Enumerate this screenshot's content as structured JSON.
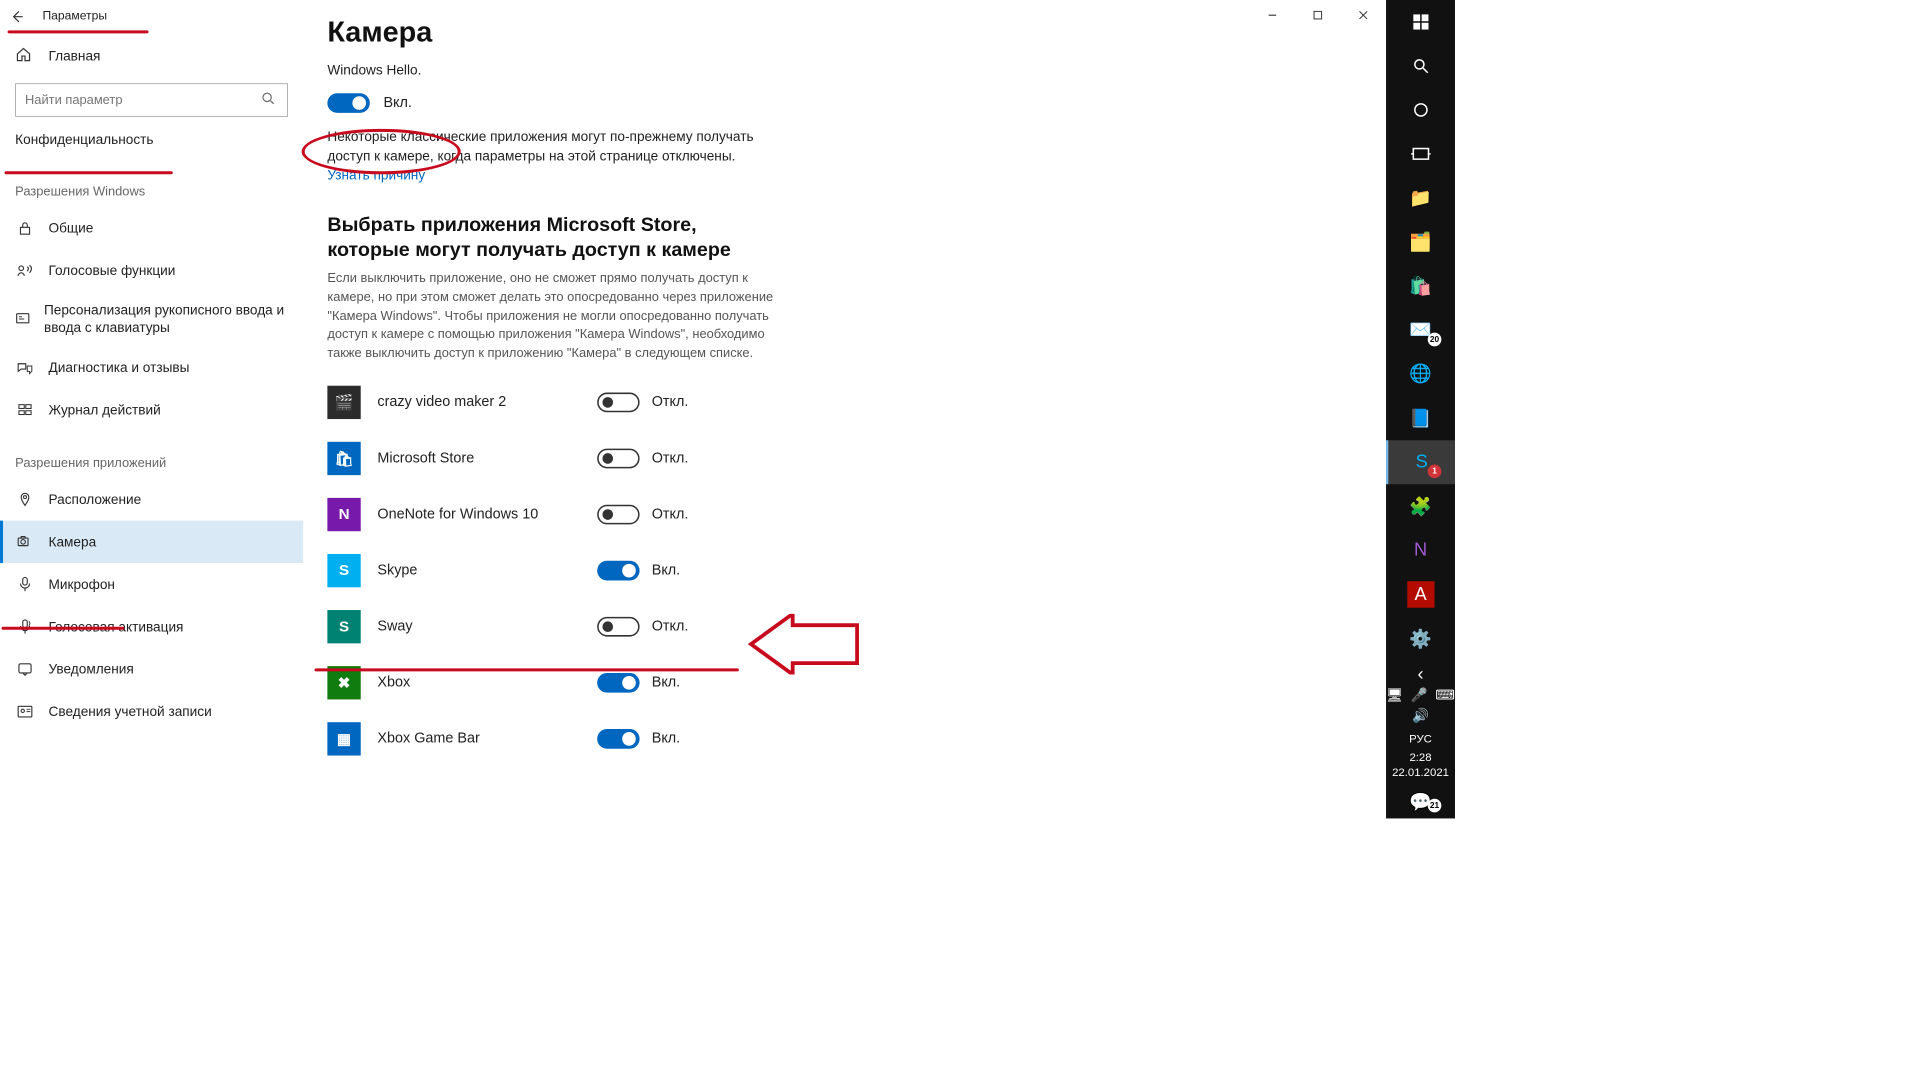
{
  "window": {
    "title": "Параметры"
  },
  "sidebar": {
    "home": "Главная",
    "search_placeholder": "Найти параметр",
    "section": "Конфиденциальность",
    "group1": "Разрешения Windows",
    "group2": "Разрешения приложений",
    "items1": [
      {
        "label": "Общие"
      },
      {
        "label": "Голосовые функции"
      },
      {
        "label": "Персонализация рукописного ввода и ввода с клавиатуры"
      },
      {
        "label": "Диагностика и отзывы"
      },
      {
        "label": "Журнал действий"
      }
    ],
    "items2": [
      {
        "label": "Расположение"
      },
      {
        "label": "Камера"
      },
      {
        "label": "Микрофон"
      },
      {
        "label": "Голосовая активация"
      },
      {
        "label": "Уведомления"
      },
      {
        "label": "Сведения учетной записи"
      }
    ]
  },
  "page": {
    "title": "Камера",
    "truncated_tail": "Windows Hello.",
    "toggle_on": "Вкл.",
    "toggle_off": "Откл.",
    "note": "Некоторые классические приложения могут по-прежнему получать доступ к камере, когда параметры на этой странице отключены.",
    "link": "Узнать причину",
    "apps_heading": "Выбрать приложения Microsoft Store, которые могут получать доступ к камере",
    "apps_desc": "Если выключить приложение, оно не сможет прямо получать доступ к камере, но при этом сможет делать это опосредованно через приложение \"Камера Windows\". Чтобы приложения не могли опосредованно получать доступ к камере с помощью приложения \"Камера Windows\", необходимо также выключить доступ к приложению \"Камера\" в следующем списке.",
    "apps": [
      {
        "name": "crazy video maker 2",
        "on": false,
        "bg": "#2b2b2b",
        "ch": "🎬"
      },
      {
        "name": "Microsoft Store",
        "on": false,
        "bg": "#0067c0",
        "ch": "🛍"
      },
      {
        "name": "OneNote for Windows 10",
        "on": false,
        "bg": "#7719aa",
        "ch": "N"
      },
      {
        "name": "Skype",
        "on": true,
        "bg": "#00aff0",
        "ch": "S"
      },
      {
        "name": "Sway",
        "on": false,
        "bg": "#008272",
        "ch": "S"
      },
      {
        "name": "Xbox",
        "on": true,
        "bg": "#107c10",
        "ch": "✖"
      },
      {
        "name": "Xbox Game Bar",
        "on": true,
        "bg": "#0067c0",
        "ch": "▦"
      }
    ]
  },
  "taskbar": {
    "lang": "РУС",
    "time": "2:28",
    "date": "22.01.2021",
    "mail_badge": "20",
    "skype_badge": "1",
    "notif_badge": "21"
  }
}
